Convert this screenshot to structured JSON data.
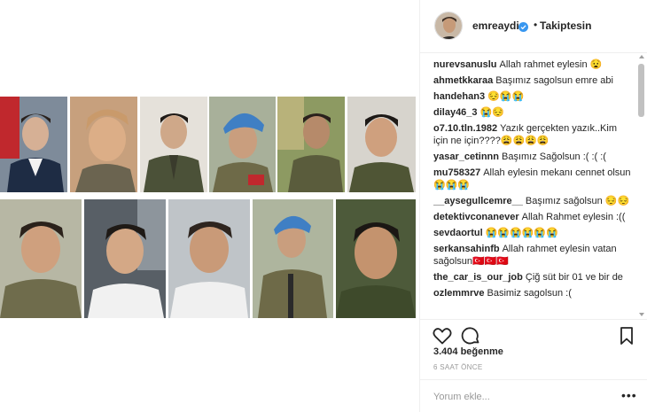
{
  "post": {
    "image_alt": "Collage of 11 soldier portraits"
  },
  "header": {
    "username": "emreaydin",
    "separator": "•",
    "follow_status": "Takiptesin",
    "verified_icon": "verified-badge-icon"
  },
  "comments": [
    {
      "user": "nurevsanuslu",
      "text": "Allah rahmet eylesin 😧"
    },
    {
      "user": "ahmetkkaraa",
      "text": "Başımız sagolsun emre abi"
    },
    {
      "user": "handehan3",
      "text": "😔😭😭"
    },
    {
      "user": "dilay46_3",
      "text": "😭😔"
    },
    {
      "user": "o7.10.tln.1982",
      "text": "Yazık gerçekten yazık..Kim için ne için????😩😩😩😩"
    },
    {
      "user": "yasar_cetinnn",
      "text": "Başımız Sağolsun :( :( :("
    },
    {
      "user": "mu758327",
      "text": "Allah eylesin mekanı cennet olsun 😭😭😭"
    },
    {
      "user": "__aysegullcemre__",
      "text": "Başımız sağolsun 😔😔"
    },
    {
      "user": "detektivconanever",
      "text": "Allah Rahmet eylesin :(("
    },
    {
      "user": "sevdaortul",
      "text": "😭😭😭😭😭😭"
    },
    {
      "user": "serkansahinfb",
      "text": "Allah rahmet eylesin vatan sağolsun🇹🇷🇹🇷🇹🇷"
    },
    {
      "user": "the_car_is_our_job",
      "text": "Çiğ süt bir 01 ve bir de"
    },
    {
      "user": "ozlemmrve",
      "text": "Basimiz sagolsun :("
    }
  ],
  "actions": {
    "like_icon": "heart-icon",
    "comment_icon": "comment-bubble-icon",
    "save_icon": "bookmark-icon"
  },
  "likes": "3.404 beğenme",
  "timestamp": "6 SAAT ÖNCE",
  "comment_box": {
    "placeholder": "Yorum ekle...",
    "more_label": "•••"
  },
  "colors": {
    "text": "#262626",
    "muted": "#999999",
    "border": "#efefef",
    "verified": "#3897f0"
  }
}
